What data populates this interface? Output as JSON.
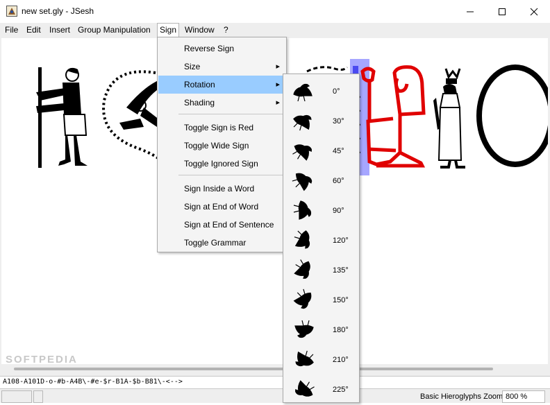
{
  "window": {
    "title": "new set.gly - JSesh",
    "app_icon": "jsesh-app-icon",
    "controls": [
      "minimize-icon",
      "maximize-icon",
      "close-icon"
    ]
  },
  "menubar": {
    "items": [
      "File",
      "Edit",
      "Insert",
      "Group Manipulation",
      "Sign",
      "Window",
      "?"
    ],
    "active": "Sign"
  },
  "sign_menu": {
    "items": {
      "reverse": "Reverse Sign",
      "size": "Size",
      "rotation": "Rotation",
      "shading": "Shading",
      "toggle_red": "Toggle Sign is Red",
      "toggle_wide": "Toggle Wide Sign",
      "toggle_ignored": "Toggle Ignored Sign",
      "inside_word": "Sign Inside a Word",
      "end_word": "Sign at End of Word",
      "end_sentence": "Sign at End of Sentence",
      "toggle_grammar": "Toggle Grammar"
    },
    "selected": "Rotation",
    "submenu_arrow": "▸"
  },
  "rotation_menu": {
    "items": [
      "0°",
      "30°",
      "45°",
      "60°",
      "90°",
      "120°",
      "135°",
      "150°",
      "180°",
      "210°",
      "225°"
    ]
  },
  "editor": {
    "code_line": "A108-A101D-o-#b-A4B\\-#e-$r-B1A-$b-B81\\-<-->",
    "zoom_label": "Basic Hieroglyphs Zoom",
    "zoom_value": "800 %",
    "watermark": "SOFTPEDIA",
    "colors": {
      "red_sign": "#e00000",
      "selection": "#8080ff",
      "menu_highlight": "#99ccff"
    }
  }
}
